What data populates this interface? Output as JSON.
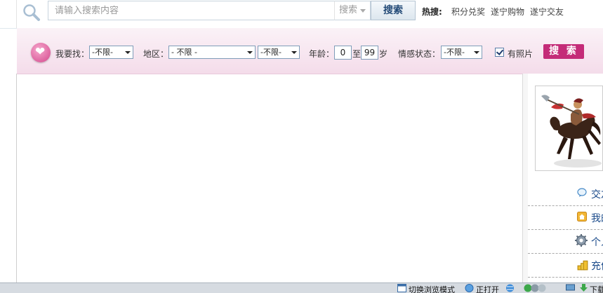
{
  "search": {
    "placeholder": "请输入搜索内容",
    "type_label": "搜索",
    "button_label": "搜索",
    "hot_label": "热搜:",
    "hot_links": [
      "积分兑奖",
      "遂宁购物",
      "遂宁交友"
    ]
  },
  "filter": {
    "looking_for_label": "我要找：",
    "looking_for_value": "-不限-",
    "region_label": "地区：",
    "region_value": "- 不限 -",
    "city_value": "-不限-",
    "age_label": "年龄：",
    "age_min": "0",
    "age_to": "至",
    "age_max": "99",
    "age_unit": "岁",
    "emotion_label": "情感状态：",
    "emotion_value": "-不限-",
    "photo_label": "有照片",
    "photo_checked": true,
    "search_button": "搜 索"
  },
  "sidebar": {
    "items": [
      {
        "label": "交友",
        "icon": "chat-bubble-icon"
      },
      {
        "label": "我的",
        "icon": "home-icon"
      },
      {
        "label": "个人",
        "icon": "gear-icon"
      },
      {
        "label": "充值",
        "icon": "coins-icon"
      }
    ]
  },
  "statusbar": {
    "switch_mode": "切换浏览模式",
    "just_opened": "正打开",
    "download": "下载"
  },
  "colors": {
    "accent_pink": "#c42b78",
    "filter_bg": "#f4dcea",
    "link_blue": "#1a4a8a"
  }
}
